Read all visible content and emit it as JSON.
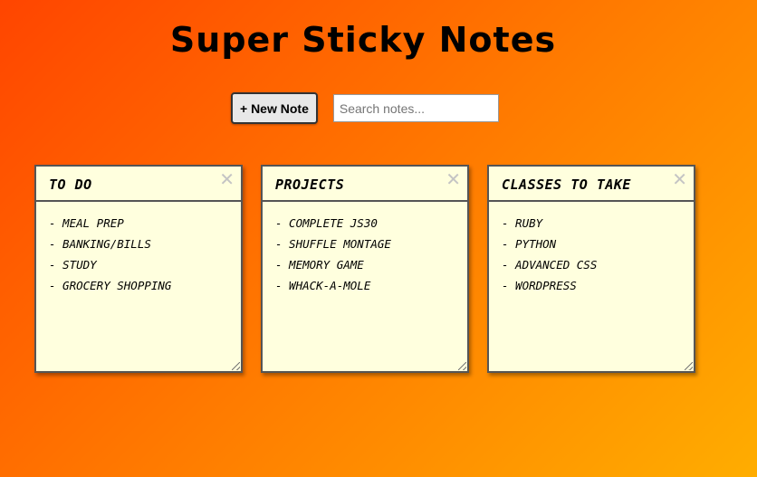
{
  "app": {
    "title": "Super Sticky Notes"
  },
  "toolbar": {
    "new_note_label": "+ New Note",
    "search_placeholder": "Search notes..."
  },
  "notes": [
    {
      "title": "To Do",
      "close": "✕",
      "lines": [
        "- Meal Prep",
        "- Banking/Bills",
        "- Study",
        "- Grocery Shopping"
      ]
    },
    {
      "title": "Projects",
      "close": "✕",
      "lines": [
        "- Complete JS30",
        "- Shuffle Montage",
        "- Memory Game",
        "- Whack-a-Mole"
      ]
    },
    {
      "title": "Classes To Take",
      "close": "✕",
      "lines": [
        "- Ruby",
        "- Python",
        "- Advanced CSS",
        "- WordPress"
      ]
    }
  ],
  "colors": {
    "gradient_start": "#ff4500",
    "gradient_end": "#ffad00",
    "note_background": "#ffffde",
    "note_border": "#555555"
  }
}
